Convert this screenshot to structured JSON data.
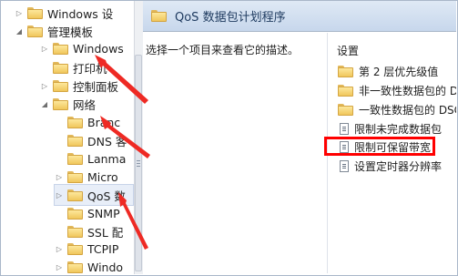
{
  "tree": {
    "items": [
      {
        "label": "Windows 设",
        "tw": "▷",
        "selected": false
      },
      {
        "label": "管理模板",
        "tw": "◢",
        "selected": false
      },
      {
        "label": "Windows",
        "tw": "▷",
        "selected": false
      },
      {
        "label": "打印机",
        "tw": "",
        "selected": false
      },
      {
        "label": "控制面板",
        "tw": "▷",
        "selected": false
      },
      {
        "label": "网络",
        "tw": "◢",
        "selected": false
      },
      {
        "label": "Branc",
        "tw": "",
        "selected": false
      },
      {
        "label": "DNS 客",
        "tw": "",
        "selected": false
      },
      {
        "label": "Lanma",
        "tw": "",
        "selected": false
      },
      {
        "label": "Micro",
        "tw": "▷",
        "selected": false
      },
      {
        "label": "QoS 数",
        "tw": "▷",
        "selected": true
      },
      {
        "label": "SNMP",
        "tw": "",
        "selected": false
      },
      {
        "label": "SSL 配",
        "tw": "",
        "selected": false
      },
      {
        "label": "TCPIP",
        "tw": "▷",
        "selected": false
      },
      {
        "label": "Windo",
        "tw": "▷",
        "selected": false
      }
    ]
  },
  "header": {
    "title": "QoS 数据包计划程序"
  },
  "description": {
    "text": "选择一个项目来查看它的描述。"
  },
  "settings": {
    "header": "设置",
    "items": [
      {
        "label": "第 2 层优先级值",
        "kind": "folder"
      },
      {
        "label": "非一致性数据包的 DS",
        "kind": "folder"
      },
      {
        "label": "一致性数据包的 DSC",
        "kind": "folder"
      },
      {
        "label": "限制未完成数据包",
        "kind": "policy"
      },
      {
        "label": "限制可保留带宽",
        "kind": "policy"
      },
      {
        "label": "设置定时器分辨率",
        "kind": "policy"
      }
    ]
  },
  "annotation": {
    "highlight_color": "#ff0000",
    "arrow_color": "#ee2a24"
  }
}
